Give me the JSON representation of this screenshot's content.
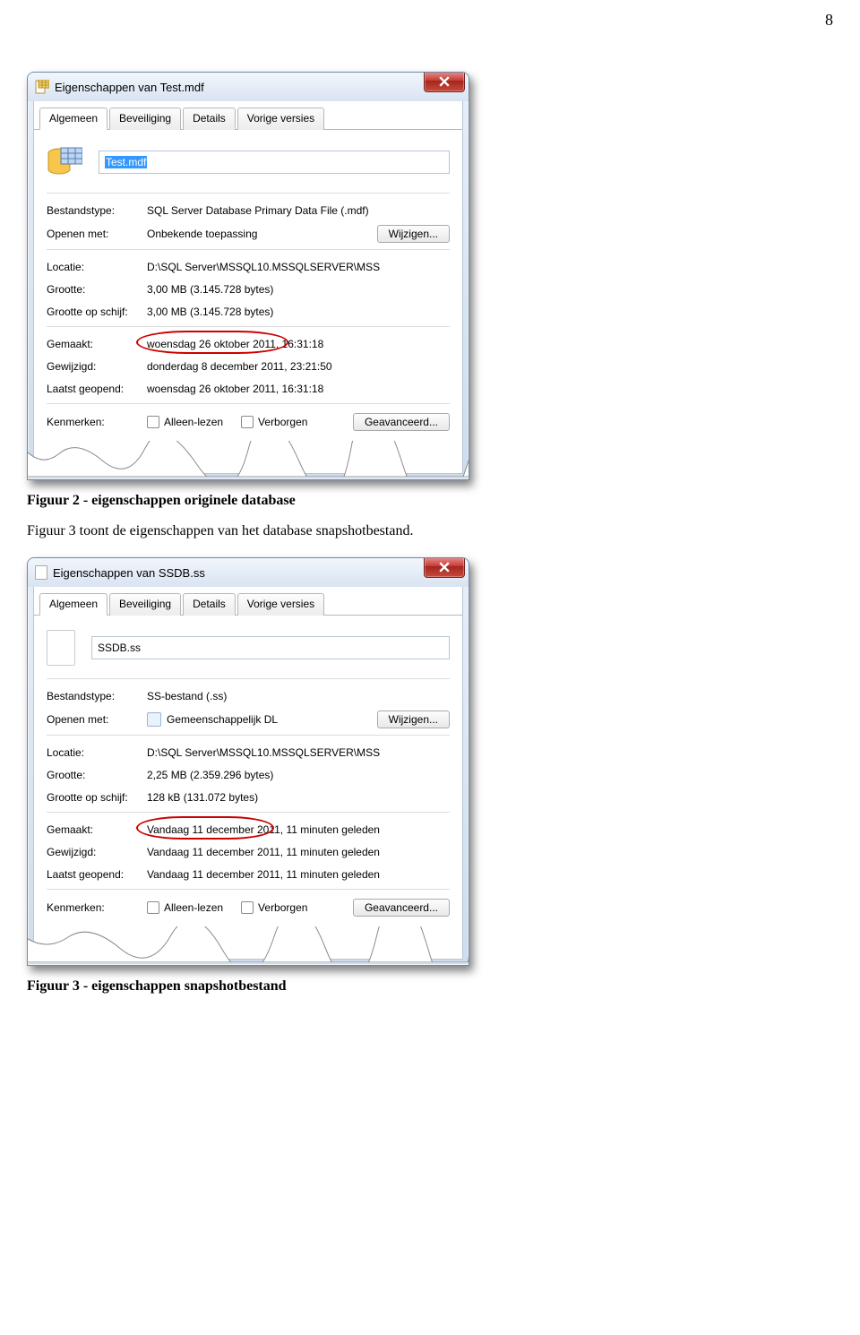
{
  "page_number": "8",
  "caption1": "Figuur 2 - eigenschappen originele database",
  "body_text": "Figuur 3 toont de eigenschappen van het database snapshotbestand.",
  "caption2": "Figuur 3 - eigenschappen snapshotbestand",
  "dialog1": {
    "title": "Eigenschappen van Test.mdf",
    "tabs": [
      "Algemeen",
      "Beveiliging",
      "Details",
      "Vorige versies"
    ],
    "filename": "Test.mdf",
    "rows": {
      "type_label": "Bestandstype:",
      "type_value": "SQL Server Database Primary Data File (.mdf)",
      "open_label": "Openen met:",
      "open_value": "Onbekende toepassing",
      "change_btn": "Wijzigen...",
      "loc_label": "Locatie:",
      "loc_value": "D:\\SQL Server\\MSSQL10.MSSQLSERVER\\MSS",
      "size_label": "Grootte:",
      "size_value": "3,00 MB (3.145.728 bytes)",
      "disk_label": "Grootte op schijf:",
      "disk_value": "3,00 MB (3.145.728 bytes)",
      "created_label": "Gemaakt:",
      "created_value": "woensdag 26 oktober 2011, 16:31:18",
      "modified_label": "Gewijzigd:",
      "modified_value": "donderdag 8 december 2011, 23:21:50",
      "accessed_label": "Laatst geopend:",
      "accessed_value": "woensdag 26 oktober 2011, 16:31:18",
      "attr_label": "Kenmerken:",
      "attr_readonly": "Alleen-lezen",
      "attr_hidden": "Verborgen",
      "advanced_btn": "Geavanceerd..."
    }
  },
  "dialog2": {
    "title": "Eigenschappen van SSDB.ss",
    "tabs": [
      "Algemeen",
      "Beveiliging",
      "Details",
      "Vorige versies"
    ],
    "filename": "SSDB.ss",
    "rows": {
      "type_label": "Bestandstype:",
      "type_value": "SS-bestand (.ss)",
      "open_label": "Openen met:",
      "open_value": "Gemeenschappelijk DL",
      "change_btn": "Wijzigen...",
      "loc_label": "Locatie:",
      "loc_value": "D:\\SQL Server\\MSSQL10.MSSQLSERVER\\MSS",
      "size_label": "Grootte:",
      "size_value": "2,25 MB (2.359.296 bytes)",
      "disk_label": "Grootte op schijf:",
      "disk_value": "128 kB (131.072 bytes)",
      "created_label": "Gemaakt:",
      "created_value": "Vandaag 11 december 2011, 11 minuten geleden",
      "modified_label": "Gewijzigd:",
      "modified_value": "Vandaag 11 december 2011, 11 minuten geleden",
      "accessed_label": "Laatst geopend:",
      "accessed_value": "Vandaag 11 december 2011, 11 minuten geleden",
      "attr_label": "Kenmerken:",
      "attr_readonly": "Alleen-lezen",
      "attr_hidden": "Verborgen",
      "advanced_btn": "Geavanceerd..."
    }
  }
}
